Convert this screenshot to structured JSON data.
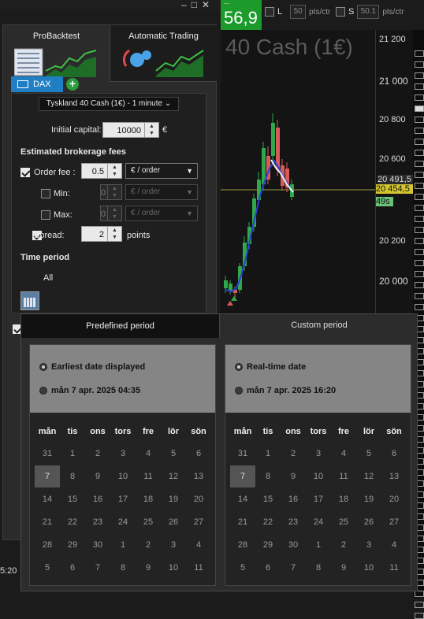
{
  "window": {
    "buttons": [
      "–",
      "□",
      "✕"
    ]
  },
  "price_box": {
    "small_label": "...",
    "value": "56,9"
  },
  "order_long": {
    "label": "L",
    "qty": "50",
    "unit": "pts/ctr"
  },
  "order_short": {
    "label": "S",
    "qty": "50.1",
    "unit": "pts/ctr"
  },
  "chart": {
    "title": "40 Cash (1€)",
    "yticks": [
      "21 200",
      "21 000",
      "20 800",
      "20 600",
      "20 491,5",
      "20 454,5",
      "20 200",
      "20 000"
    ],
    "price_tag": "20 454,5",
    "timer_tag": "49s",
    "colors": {
      "up": "#2ea84a",
      "down": "#d95a5a",
      "ma": "#2b3fd6",
      "line": "#b6b640"
    }
  },
  "tabs": {
    "probacktest": "ProBacktest",
    "auto_trading": "Automatic Trading"
  },
  "dax_tab": "DAX",
  "instrument": "Tyskland 40 Cash (1€) - 1 minute",
  "form": {
    "initial_capital_label": "Initial capital:",
    "initial_capital": "10000",
    "currency": "€",
    "fees_heading": "Estimated brokerage fees",
    "order_fee_label": "Order fee :",
    "order_fee": "0.5",
    "order_fee_unit": "€ / order",
    "min_label": "Min:",
    "min_value": "0",
    "min_unit": "€ / order",
    "max_label": "Max:",
    "max_value": "0",
    "max_unit": "€ / order",
    "spread_label": "Spread:",
    "spread_value": "2",
    "spread_unit": "points",
    "time_heading": "Time period",
    "time_value": "All"
  },
  "popup": {
    "tab_predefined": "Predefined period",
    "tab_custom": "Custom period",
    "left": {
      "option1": "Earliest date displayed",
      "option2": "mån 7 apr. 2025 04:35"
    },
    "right": {
      "option1": "Real-time date",
      "option2": "mån 7 apr. 2025 16:20"
    },
    "weekdays": [
      "mån",
      "tis",
      "ons",
      "tors",
      "fre",
      "lör",
      "sön"
    ],
    "weeks": [
      [
        "31",
        "1",
        "2",
        "3",
        "4",
        "5",
        "6"
      ],
      [
        "7",
        "8",
        "9",
        "10",
        "11",
        "12",
        "13"
      ],
      [
        "14",
        "15",
        "16",
        "17",
        "18",
        "19",
        "20"
      ],
      [
        "21",
        "22",
        "23",
        "24",
        "25",
        "26",
        "27"
      ],
      [
        "28",
        "29",
        "30",
        "1",
        "2",
        "3",
        "4"
      ],
      [
        "5",
        "6",
        "7",
        "8",
        "9",
        "10",
        "11"
      ]
    ],
    "selected_day": "7"
  },
  "timestamp": "5:20"
}
